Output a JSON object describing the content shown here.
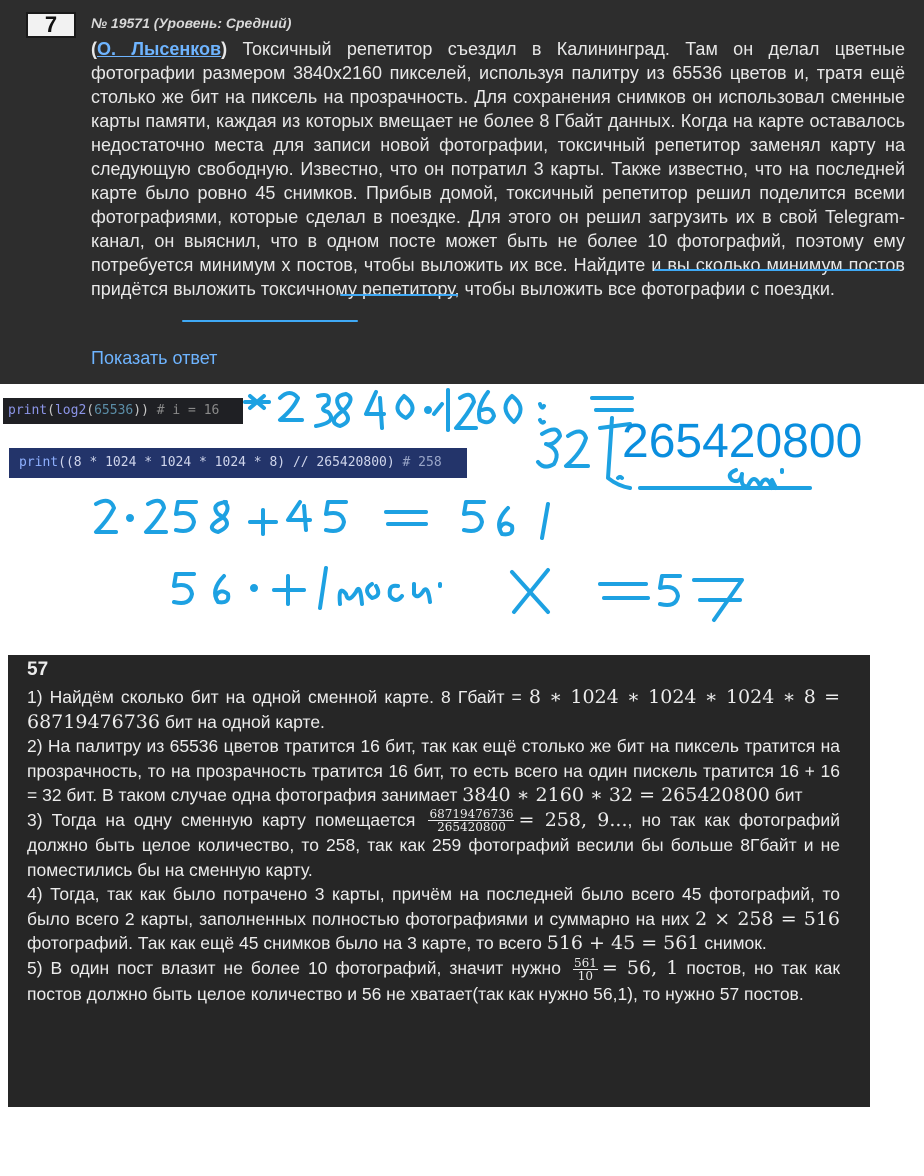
{
  "task": {
    "number": "7",
    "meta": "№ 19571 (Уровень: Средний)",
    "paren_open": "(",
    "author": "О. Лысенков",
    "paren_close": ")",
    "text": " Токсичный репетитор съездил в Калининград. Там он делал цветные фотографии размером 3840x2160 пикселей, используя палитру из 65536 цветов и, тратя ещё столько же бит на пиксель на прозрачность. Для сохранения снимков он использовал сменные карты памяти, каждая из которых вмещает не более 8 Гбайт данных. Когда на карте оставалось недостаточно места для записи новой фотографии, токсичный репетитор заменял карту на следующую свободную. Известно, что он потратил 3 карты. Также известно, что на последней карте было ровно 45 снимков. Прибыв домой, токсичный репетитор решил поделится всеми фотографиями, которые сделал в поездке. Для этого он решил загрузить их в свой Telegram-канал, он выяснил, что в одном посте может быть не более 10 фотографий, поэтому ему потребуется минимум x постов, чтобы выложить их все. Найдите и вы сколько минимум постов придётся выложить токсичному репетитору, чтобы выложить все фотографии с поездки.",
    "show_answer": "Показать ответ"
  },
  "code": {
    "line1": {
      "fn": "print",
      "open": "(",
      "fn2": "log2",
      "open2": "(",
      "num": "65536",
      "close": "))",
      "comment": "  # i = 16"
    },
    "line2": {
      "fn": "print",
      "expr": "((8 * 1024 * 1024 * 1024 * 8) // 265420800)",
      "comment": "  # 258"
    }
  },
  "handwriting": {
    "big_number": "265420800"
  },
  "solution": {
    "answer": "57",
    "p1": {
      "a": "1)  Найдём сколько бит на одной сменной карте. 8 Гбайт = ",
      "m1": "8 ∗ 1024 ∗ 1024 ∗  1024 ∗ 8 = 68719476736",
      "b": " бит на одной карте."
    },
    "p2": {
      "a": "2)  На палитру из 65536 цветов тратится 16 бит, так как ещё столько же бит на пиксель тратится на прозрачность, то на прозрачность тратится 16 бит, то есть всего на один пискель тратится 16 + 16 = 32 бит. В таком случае  одна фотография занимает ",
      "m1": "3840 ∗ 2160 ∗ 32 = 265420800",
      "b": " бит"
    },
    "p3": {
      "a": "3) Тогда на одну сменную карту помещается ",
      "frac_num": "68719476736",
      "frac_den": "265420800",
      "m1": "= 258, 9...",
      "b": ", но так как фотографий должно быть целое количество, то 258, так как 259 фотографий весили бы больше 8Гбайт и не поместились бы на сменную карту."
    },
    "p4": {
      "a": "4) Тогда, так как было потрачено  3 карты, причём на последней было всего 45 фотографий, то было всего 2 карты, заполненных полностью фотографиями и суммарно на них ",
      "m1": "2 × 258 = 516",
      "b": " фотографий. Так как  ещё 45 снимков было на 3 карте, то всего ",
      "m2": "516 + 45 = 561",
      "c": " снимок."
    },
    "p5": {
      "a": "5) В один пост влазит не более 10 фотографий, значит нужно ",
      "frac_num": "561",
      "frac_den": "10",
      "m1": "= 56, 1",
      "b": " постов, но так как постов должно быть целое количество и 56 не хватает(так как нужно 56,1), то нужно 57 постов."
    }
  },
  "colors": {
    "panel_bg": "#2d2d2d",
    "link": "#6eb4ff",
    "ink": "#1da1e2"
  }
}
